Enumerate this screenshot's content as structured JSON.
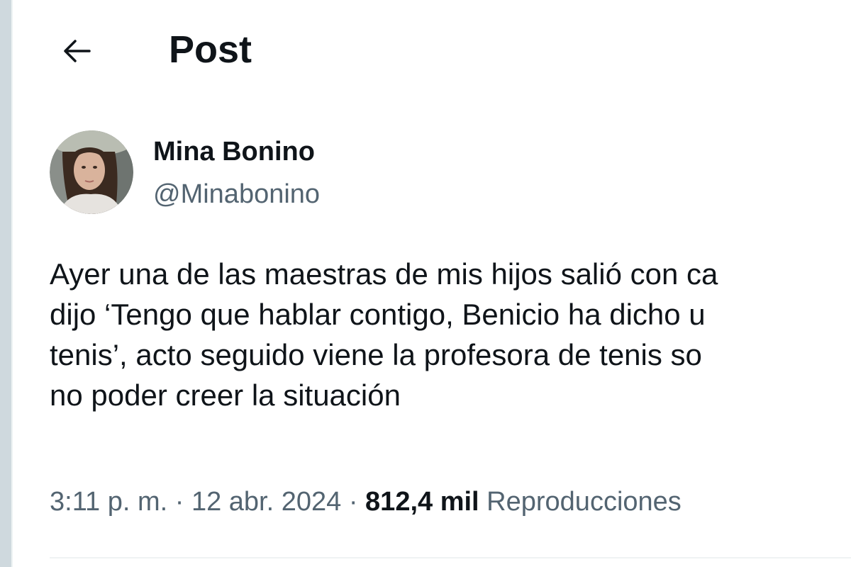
{
  "header": {
    "back_icon": "arrow-left-icon",
    "title": "Post"
  },
  "author": {
    "display_name": "Mina Bonino",
    "handle": "@Minabonino",
    "avatar_icon": "avatar-photo"
  },
  "post": {
    "lines": [
      "Ayer una de las maestras de mis hijos salió con ca",
      "dijo ‘Tengo que hablar contigo, Benicio ha dicho u",
      "tenis’, acto seguido viene la profesora de tenis so",
      "no poder creer la situación"
    ]
  },
  "meta": {
    "time": "3:11 p. m.",
    "separator": "·",
    "date": "12 abr. 2024",
    "views_count": "812,4 mil",
    "views_label": "Reproducciones"
  },
  "colors": {
    "text_primary": "#0f1419",
    "text_secondary": "#536471",
    "divider": "#eff3f4",
    "rail": "#cfd9de"
  }
}
